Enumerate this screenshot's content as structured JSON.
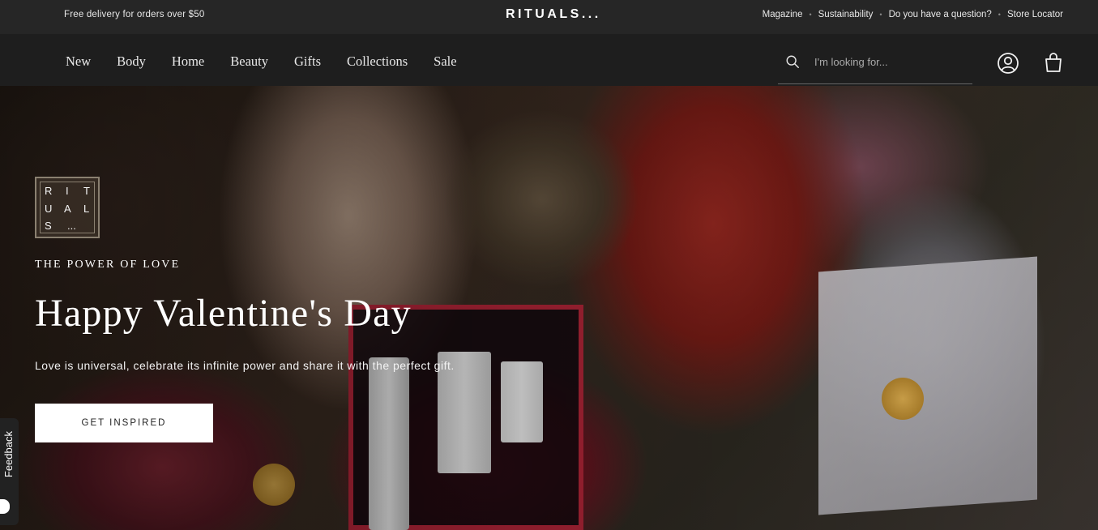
{
  "topbar": {
    "promo": "Free delivery for orders over $50",
    "logo": "RITUALS...",
    "links": [
      "Magazine",
      "Sustainability",
      "Do you have a question?",
      "Store Locator"
    ]
  },
  "nav": {
    "items": [
      "New",
      "Body",
      "Home",
      "Beauty",
      "Gifts",
      "Collections",
      "Sale"
    ],
    "search_placeholder": "I'm looking for..."
  },
  "hero": {
    "brandmark": [
      "R",
      "I",
      "T",
      "U",
      "A",
      "L",
      "S",
      "...",
      ""
    ],
    "eyebrow": "THE POWER OF LOVE",
    "headline": "Happy Valentine's Day",
    "subtext": "Love is universal, celebrate its infinite power and share it with the perfect gift.",
    "cta": "GET INSPIRED"
  },
  "feedback": {
    "label": "Feedback"
  }
}
